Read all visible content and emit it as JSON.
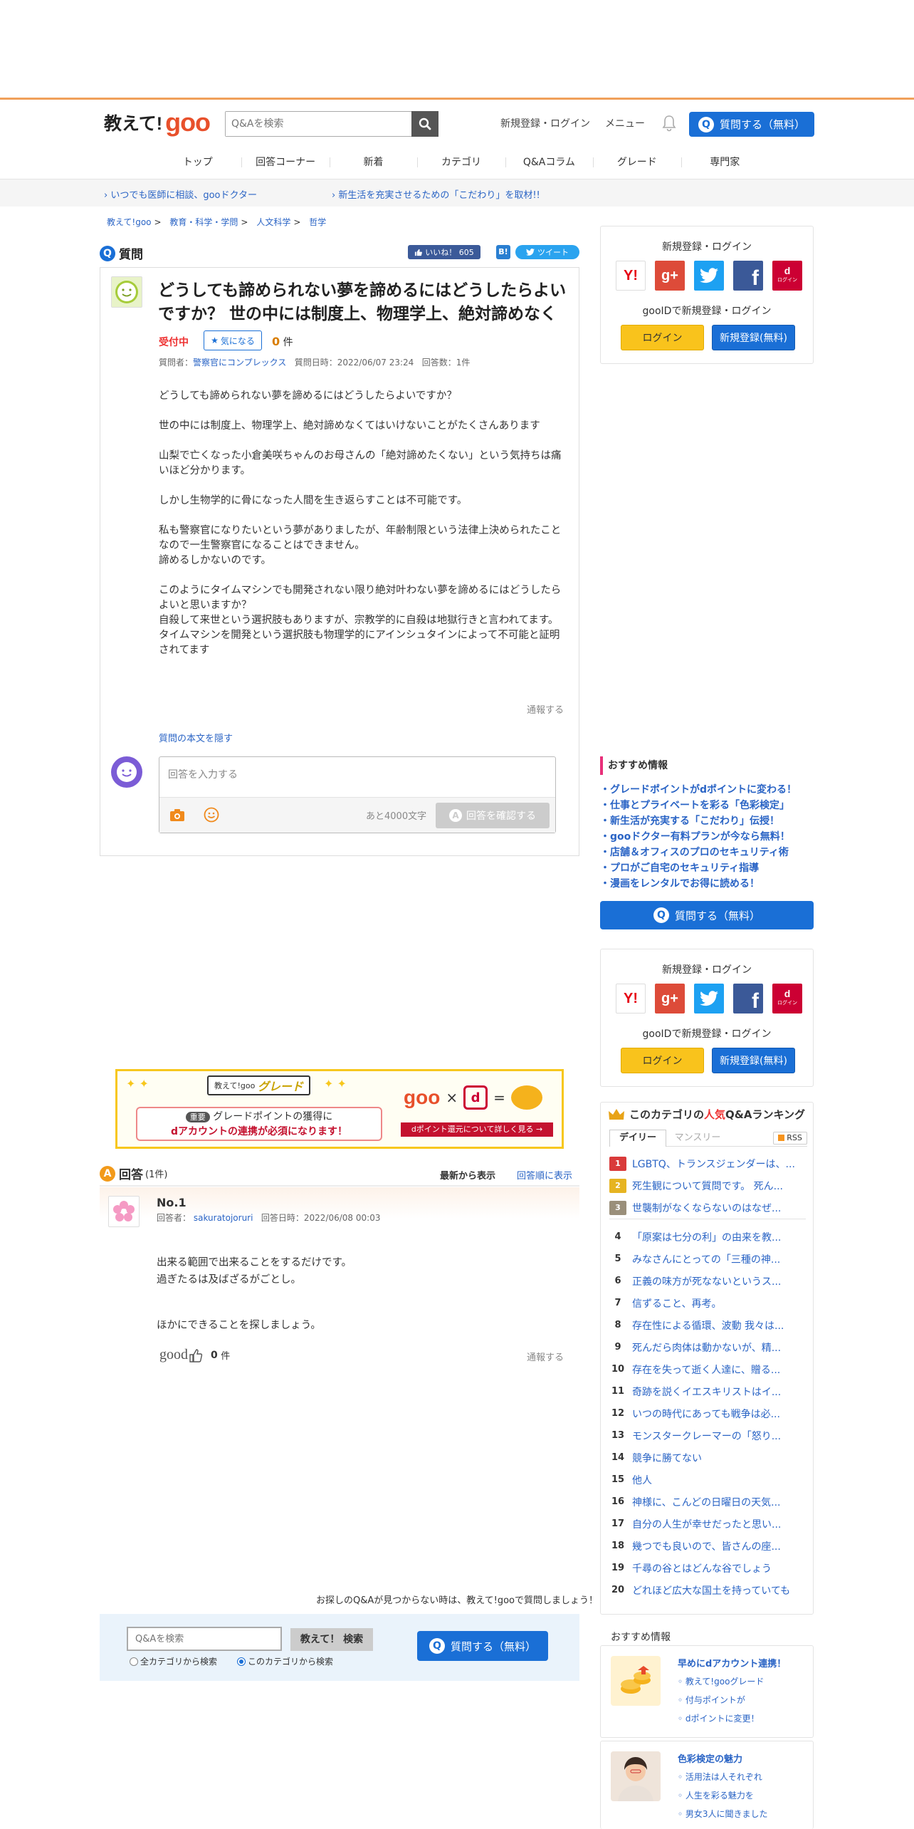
{
  "header": {
    "logo_main": "教えて!",
    "logo_goo": "goo",
    "search_placeholder": "Q&Aを検索",
    "register_login": "新規登録・ログイン",
    "menu": "メニュー",
    "ask_button": "質問する（無料）"
  },
  "nav": [
    "トップ",
    "回答コーナー",
    "新着",
    "カテゴリ",
    "Q&Aコラム",
    "グレード",
    "専門家"
  ],
  "subbar": {
    "link1": "いつでも医師に相談、gooドクター",
    "link2": "新生活を充実させるための「こだわり」を取材!!"
  },
  "breadcrumb": [
    "教えて!goo",
    "教育・科学・学問",
    "人文科学",
    "哲学"
  ],
  "question": {
    "section_label": "質問",
    "like_label": "いいね！",
    "like_count": "605",
    "hatena": "B!",
    "tweet": "ツイート",
    "title": "どうしても諦められない夢を諦めるにはどうしたらよいですか？ 世の中には制度上、物理学上、絶対諦めなく",
    "status": "受付中",
    "fav_label": "気になる",
    "fav_count": "0",
    "fav_unit": "件",
    "meta_asker_label": "質問者：",
    "meta_asker": "警察官にコンプレックス",
    "meta_date": "質問日時：2022/06/07 23:24",
    "meta_answers": "回答数：1件",
    "paragraphs": [
      "どうしても諦められない夢を諦めるにはどうしたらよいですか？",
      "世の中には制度上、物理学上、絶対諦めなくてはいけないことがたくさんあります",
      "山梨で亡くなった小倉美咲ちゃんのお母さんの「絶対諦めたくない」という気持ちは痛いほど分かります。",
      "しかし生物学的に骨になった人間を生き返らすことは不可能です。",
      "私も警察官になりたいという夢がありましたが、年齢制限という法律上決められたことなので一生警察官になることはできません。\n諦めるしかないのです。",
      "",
      "このようにタイムマシンでも開発されない限り絶対叶わない夢を諦めるにはどうしたらよいと思いますか？\n自殺して来世という選択肢もありますが、宗教学的に自殺は地獄行きと言われてます。\nタイムマシンを開発という選択肢も物理学的にアインシュタインによって不可能と証明されてます"
    ],
    "report": "通報する",
    "hide_body": "質問の本文を隠す",
    "answer_placeholder": "回答を入力する",
    "chars_left": "あと4000文字",
    "confirm_button": "回答を確認する"
  },
  "sidebar": {
    "login_title": "新規登録・ログイン",
    "gooid_title": "gooIDで新規登録・ログイン",
    "login_button": "ログイン",
    "register_button": "新規登録(無料)",
    "sns": [
      {
        "label": "Y!",
        "color": "#ffffff",
        "fg": "#e60012",
        "border": "#ddd"
      },
      {
        "label": "g+",
        "color": "#dd4b39",
        "fg": "#ffffff",
        "border": "#dd4b39"
      },
      {
        "label": "t",
        "color": "#1da1f2",
        "fg": "#ffffff",
        "border": "#1da1f2"
      },
      {
        "label": "f",
        "color": "#3b5998",
        "fg": "#ffffff",
        "border": "#3b5998"
      },
      {
        "label": "d",
        "color": "#cc0033",
        "fg": "#ffffff",
        "border": "#cc0033"
      }
    ],
    "docomo_sub": "ログイン",
    "reco_title": "おすすめ情報",
    "reco_items": [
      "グレードポイントがdポイントに変わる！",
      "仕事とプライベートを彩る「色彩検定」",
      "新生活が充実する「こだわり」伝授！",
      "gooドクター有料プランが今なら無料！",
      "店舗＆オフィスのプロのセキュリティ術",
      "プロがご自宅のセキュリティ指導",
      "漫画をレンタルでお得に読める！"
    ],
    "ask_button": "質問する（無料）"
  },
  "banner": {
    "badge": "教えて!goo",
    "grade": "グレード",
    "line_tag": "重要",
    "line1": "グレードポイントの獲得に",
    "line2": "dアカウントの連携が必須になります！",
    "right_goo": "goo",
    "right_times": "×",
    "right_eq": "=",
    "right_btn": "dポイント還元について詳しく見る →"
  },
  "answers": {
    "label": "回答",
    "count": "(1件)",
    "sort_latest": "最新から表示",
    "sort_order": "回答順に表示",
    "item": {
      "no": "No.1",
      "responder_label": "回答者：",
      "responder": "sakuratojoruri",
      "date": "回答日時：2022/06/08 00:03",
      "paragraphs": [
        "出来る範囲で出来ることをするだけです。\n過ぎたるは及ばざるがごとし。",
        "",
        "ほかにできることを探しましょう。"
      ],
      "good": "good",
      "good_count": "0",
      "good_unit": "件",
      "report": "通報する"
    }
  },
  "ranking": {
    "title_pre": "このカテゴリの",
    "title_hi": "人気",
    "title_post": "Q&Aランキング",
    "tab_daily": "デイリー",
    "tab_monthly": "マンスリー",
    "rss": "RSS",
    "items": [
      "LGBTQ、トランスジェンダーは、...",
      "死生観について質問です。 死ん...",
      "世襲制がなくならないのはなぜ...",
      "「原案は七分の利」の由来を教...",
      "みなさんにとっての「三種の神...",
      "正義の味方が死なないというス...",
      "信ずること、再考。",
      "存在性による循環、波動 我々は...",
      "死んだら肉体は動かないが、精...",
      "存在を失って逝く人達に、贈る...",
      "奇跡を説くイエスキリストはイ...",
      "いつの時代にあっても戦争は必...",
      "モンスタークレーマーの「怒り...",
      "競争に勝てない",
      "他人",
      "神様に、こんどの日曜日の天気...",
      "自分の人生が幸せだったと思い...",
      "幾つでも良いので、皆さんの座...",
      "千尋の谷とはどんな谷でしょう",
      "どれほど広大な国土を持っていても"
    ]
  },
  "bottom": {
    "prompt": "お探しのQ&Aが見つからない時は、教えて!gooで質問しましょう！",
    "search_placeholder": "Q&Aを検索",
    "search_button": "教えて！ 検索",
    "radio_all": "全カテゴリから検索",
    "radio_this": "このカテゴリから検索",
    "ask_button": "質問する（無料）"
  },
  "osusume2": {
    "title": "おすすめ情報",
    "tile1": {
      "title": "早めにdアカウント連携！",
      "items": [
        "教えて!gooグレード",
        "付与ポイントが",
        "dポイントに変更！"
      ]
    },
    "tile2": {
      "title": "色彩検定の魅力",
      "items": [
        "活用法は人それぞれ",
        "人生を彩る魅力を",
        "男女3人に聞きました"
      ]
    }
  }
}
